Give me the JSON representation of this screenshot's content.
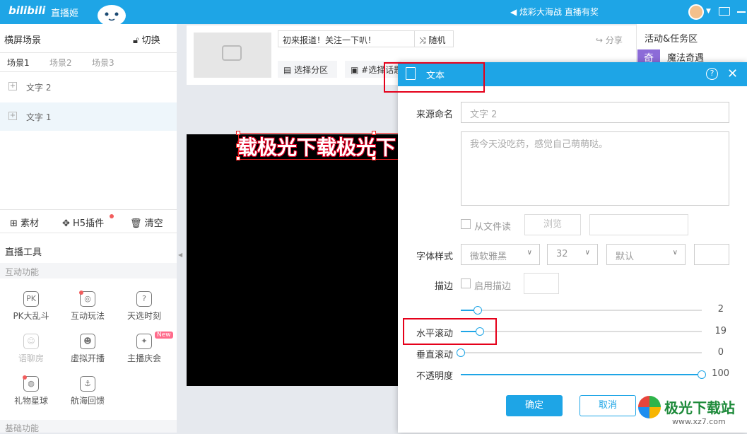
{
  "topbar": {
    "logo": "bilibili",
    "app_name": "直播姬",
    "announcement": "炫彩大海战 直播有奖"
  },
  "left": {
    "scene_title": "横屏场景",
    "switch_label": "切换",
    "tabs": [
      "场景1",
      "场景2",
      "场景3"
    ],
    "sources": [
      "文字 2",
      "文字 1"
    ],
    "toolbar": {
      "material": "素材",
      "h5": "H5插件",
      "clear": "清空"
    },
    "live_tools_title": "直播工具",
    "interactive_label": "互动功能",
    "tools": [
      "PK大乱斗",
      "互动玩法",
      "天选时刻",
      "语聊房",
      "虚拟开播",
      "主播庆会",
      "礼物星球",
      "航海回馈"
    ],
    "new_badge": "New",
    "basic_label": "基础功能"
  },
  "room": {
    "title": "初来报道！关注一下叭！",
    "random": "随机",
    "share": "分享",
    "area": "选择分区",
    "topic": "#选择话题"
  },
  "preview": {
    "text": "载极光下载极光下"
  },
  "right": {
    "title": "活动&任务区",
    "icon_char": "奇",
    "item": "魔法奇遇"
  },
  "dialog": {
    "title": "文本",
    "help": "?",
    "close": "✕",
    "source_label": "来源命名",
    "source_placeholder": "文字 2",
    "text_content": "我今天没吃药，感觉自己萌萌哒。",
    "from_file": "从文件读",
    "browse": "浏览",
    "font_label": "字体样式",
    "font_family": "微软雅黑",
    "font_size": "32",
    "font_style": "默认",
    "stroke_label": "描边",
    "enable_stroke": "启用描边",
    "stroke_value": "2",
    "hscroll_label": "水平滚动",
    "hscroll_value": "19",
    "vscroll_label": "垂直滚动",
    "vscroll_value": "0",
    "opacity_label": "不透明度",
    "opacity_value": "100",
    "ok": "确定",
    "cancel": "取消"
  },
  "sliders": {
    "stroke": 0.07,
    "hscroll": 0.08,
    "vscroll": 0.0,
    "opacity": 1.0
  },
  "watermark": {
    "text": "极光下载站",
    "url": "www.xz7.com"
  },
  "colors": {
    "accent": "#1ea5e6",
    "highlight": "#e5001a"
  }
}
